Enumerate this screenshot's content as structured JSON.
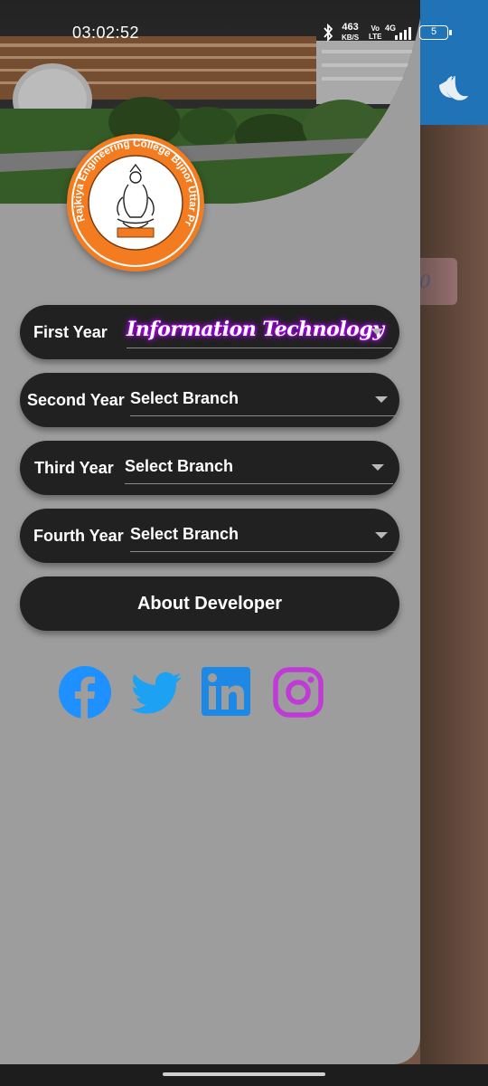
{
  "status_bar": {
    "time": "03:02:52",
    "net_speed": "463",
    "net_unit": "KB/S",
    "volte": "Vo\nLTE",
    "network": "4G",
    "battery": "5"
  },
  "drawer": {
    "years": [
      {
        "label": "First Year",
        "value": "Information Technology"
      },
      {
        "label": "Second Year",
        "value": "Select Branch"
      },
      {
        "label": "Third Year",
        "value": "Select Branch"
      },
      {
        "label": "Fourth Year",
        "value": "Select Branch"
      }
    ],
    "about_label": "About Developer",
    "logo_text": "Rajkiya Engineering College Bijnor Uttar Pradesh",
    "social": [
      "facebook-icon",
      "twitter-icon",
      "linkedin-icon",
      "instagram-icon"
    ]
  },
  "background_app": {
    "pill_text": "0"
  },
  "colors": {
    "drawer_bg": "#9d9d9d",
    "row_bg": "#212121",
    "accent_blue": "#1f73b6",
    "brand_orange": "#f47c20",
    "facebook": "#1e90ff",
    "twitter": "#1da1f2",
    "linkedin": "#1e88e5",
    "instagram": "#c03ad6"
  }
}
